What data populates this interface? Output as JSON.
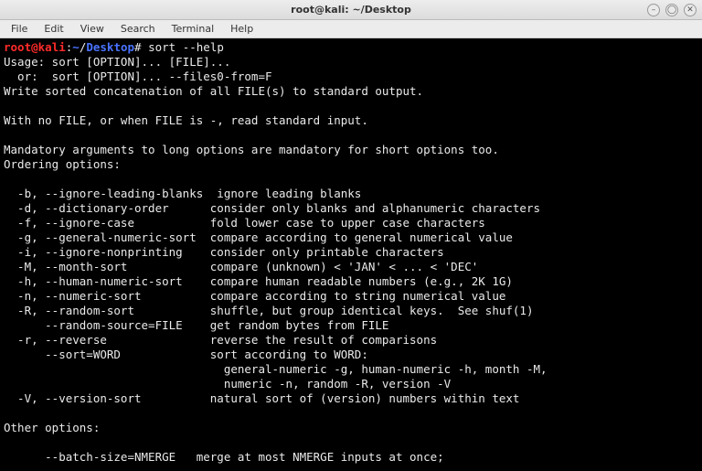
{
  "window": {
    "title": "root@kali: ~/Desktop"
  },
  "menubar": {
    "file": "File",
    "edit": "Edit",
    "view": "View",
    "search": "Search",
    "terminal": "Terminal",
    "help": "Help"
  },
  "prompt": {
    "user": "root",
    "at": "@",
    "host": "kali",
    "colon": ":",
    "tilde": "~",
    "slash": "/",
    "dir": "Desktop",
    "sigil": "# "
  },
  "command": "sort --help",
  "output": {
    "l01": "Usage: sort [OPTION]... [FILE]...",
    "l02": "  or:  sort [OPTION]... --files0-from=F",
    "l03": "Write sorted concatenation of all FILE(s) to standard output.",
    "l04": "",
    "l05": "With no FILE, or when FILE is -, read standard input.",
    "l06": "",
    "l07": "Mandatory arguments to long options are mandatory for short options too.",
    "l08": "Ordering options:",
    "l09": "",
    "l10": "  -b, --ignore-leading-blanks  ignore leading blanks",
    "l11": "  -d, --dictionary-order      consider only blanks and alphanumeric characters",
    "l12": "  -f, --ignore-case           fold lower case to upper case characters",
    "l13": "  -g, --general-numeric-sort  compare according to general numerical value",
    "l14": "  -i, --ignore-nonprinting    consider only printable characters",
    "l15": "  -M, --month-sort            compare (unknown) < 'JAN' < ... < 'DEC'",
    "l16": "  -h, --human-numeric-sort    compare human readable numbers (e.g., 2K 1G)",
    "l17": "  -n, --numeric-sort          compare according to string numerical value",
    "l18": "  -R, --random-sort           shuffle, but group identical keys.  See shuf(1)",
    "l19": "      --random-source=FILE    get random bytes from FILE",
    "l20": "  -r, --reverse               reverse the result of comparisons",
    "l21": "      --sort=WORD             sort according to WORD:",
    "l22": "                                general-numeric -g, human-numeric -h, month -M,",
    "l23": "                                numeric -n, random -R, version -V",
    "l24": "  -V, --version-sort          natural sort of (version) numbers within text",
    "l25": "",
    "l26": "Other options:",
    "l27": "",
    "l28": "      --batch-size=NMERGE   merge at most NMERGE inputs at once;"
  },
  "controls": {
    "minimize": "–",
    "maximize": "◯",
    "close": "✕"
  }
}
